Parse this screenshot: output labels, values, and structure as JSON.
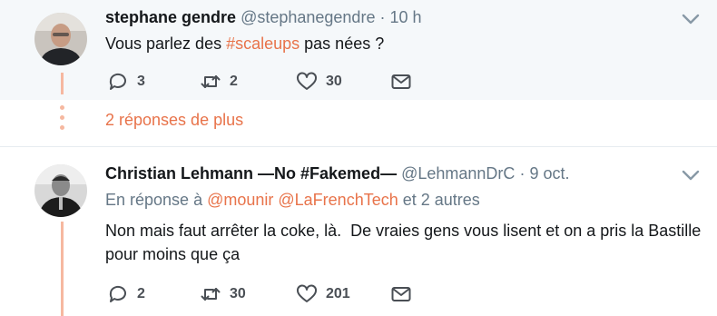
{
  "tweet1": {
    "name": "stephane gendre",
    "handle": "@stephanegendre",
    "separator": "·",
    "time": "10 h",
    "text_before": "Vous parlez des ",
    "hashtag": "#scaleups",
    "text_after": " pas nées ?",
    "replies": "3",
    "retweets": "2",
    "likes": "30"
  },
  "more_replies": "2 réponses de plus",
  "tweet2": {
    "name": "Christian Lehmann —No #Fakemed—",
    "handle": "@LehmannDrC",
    "separator": "·",
    "time": "9 oct.",
    "reply_prefix": "En réponse à ",
    "mention1": "@mounir",
    "mention2": "@LaFrenchTech",
    "reply_suffix": " et 2 autres",
    "text_line1": "Non mais faut arrêter la coke, là.  De vraies gens vous lisent et on a pris la Bastille",
    "text_line2": "pour moins que ça",
    "replies": "2",
    "retweets": "30",
    "likes": "201"
  },
  "icons": {
    "reply": "reply-icon",
    "retweet": "retweet-icon",
    "like": "heart-icon",
    "message": "envelope-icon",
    "menu": "chevron-down-icon"
  },
  "colors": {
    "accent": "#e8734a",
    "thread_line": "#f6b8a0",
    "muted": "#657786",
    "highlight_bg": "#f5f8fa"
  }
}
